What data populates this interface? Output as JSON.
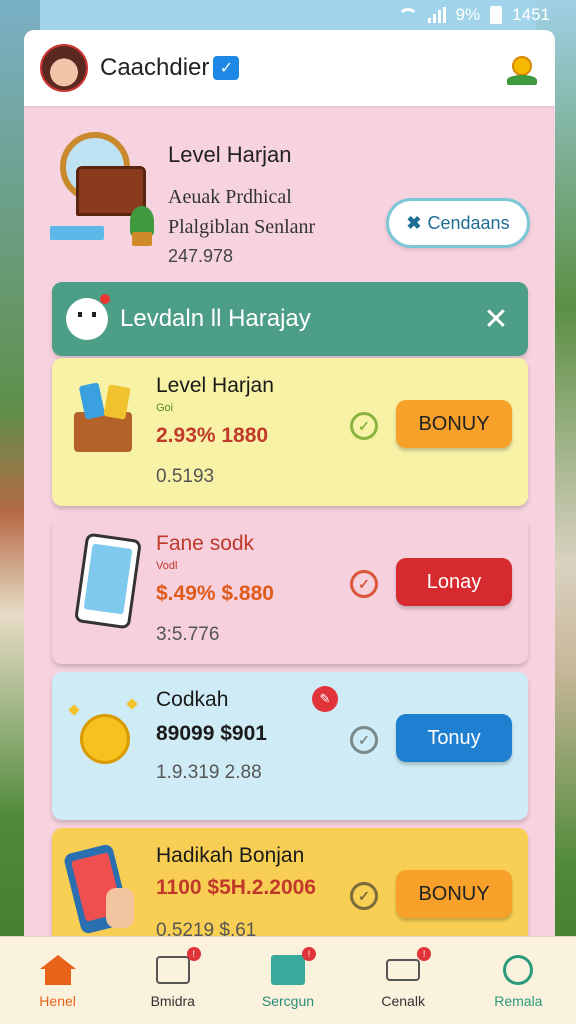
{
  "status_bar": {
    "battery_pct": "9%",
    "time": "1451"
  },
  "header": {
    "title": "Caachdier",
    "verified": "✓"
  },
  "hero": {
    "title": "Level Harjan",
    "subtitle1": "Aeuak Prdhical",
    "subtitle2": "Plalgiblan Senlanr",
    "number": "247.978",
    "button_label": "Cendaans"
  },
  "banner": {
    "text": "Levdaln ll Harajay",
    "close": "✕"
  },
  "cards": [
    {
      "title": "Level Harjan",
      "tag": "Goi",
      "price": "2.93% 1880",
      "sub": "0.5193",
      "button": "BONUY",
      "colors": {
        "price": "#c0392b",
        "check": "#8ab33f",
        "button": "#f7a12a"
      }
    },
    {
      "title": "Fane sodk",
      "tag": "Vodl",
      "price": "$.49% $.880",
      "sub": "3:5.776",
      "button": "Lonay",
      "colors": {
        "price": "#e05a1a",
        "check": "#d9553a",
        "button": "#d62a2f"
      }
    },
    {
      "title": "Codkah",
      "tag": "",
      "price": "89099 $901",
      "sub": "1.9.319 2.88",
      "button": "Tonuy",
      "colors": {
        "price": "#1a1a1a",
        "check": "#7a8a8a",
        "button": "#1f7fd1"
      }
    },
    {
      "title": "Hadikah Bonjan",
      "tag": "",
      "price": "1100 $5H.2.2006",
      "sub": "0.5219 $.61",
      "button": "BONUY",
      "colors": {
        "price": "#c0392b",
        "check": "#7a6a3a",
        "button": "#f7a12a"
      }
    }
  ],
  "nav": [
    {
      "label": "Henel",
      "icon": "home-icon"
    },
    {
      "label": "Bmidra",
      "icon": "games-icon"
    },
    {
      "label": "Sercgun",
      "icon": "store-icon"
    },
    {
      "label": "Cenalk",
      "icon": "delivery-icon"
    },
    {
      "label": "Remala",
      "icon": "compass-icon"
    }
  ]
}
